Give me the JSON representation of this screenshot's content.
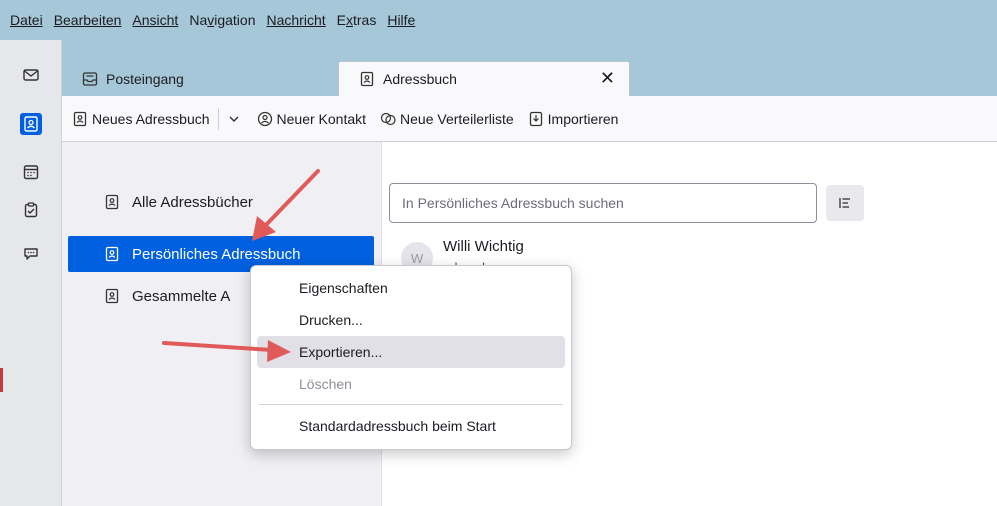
{
  "menubar": {
    "items": [
      {
        "label": "Datei",
        "accel_index": 0
      },
      {
        "label": "Bearbeiten",
        "accel_index": 0
      },
      {
        "label": "Ansicht",
        "accel_index": 0
      },
      {
        "label": "Navigation",
        "accel_index": 2
      },
      {
        "label": "Nachricht",
        "accel_index": 0
      },
      {
        "label": "Extras",
        "accel_index": 1
      },
      {
        "label": "Hilfe",
        "accel_index": 0
      }
    ]
  },
  "spaces": {
    "items": [
      "mail-icon",
      "address-book-icon",
      "calendar-icon",
      "tasks-icon",
      "chat-icon"
    ],
    "active": "address-book-icon",
    "accent_color": "#0060df"
  },
  "tabs": [
    {
      "label": "Posteingang",
      "icon": "inbox-icon"
    },
    {
      "label": "Adressbuch",
      "icon": "address-book-icon",
      "close_label": "✕"
    }
  ],
  "toolbar": {
    "new_book": "Neues Adressbuch",
    "new_contact": "Neuer Kontakt",
    "new_list": "Neue Verteilerliste",
    "import": "Importieren"
  },
  "sidebar": {
    "books": [
      {
        "label": "Alle Adressbücher"
      },
      {
        "label": "Persönliches Adressbuch"
      },
      {
        "label": "Gesammelte A"
      }
    ],
    "selected_index": 1
  },
  "search": {
    "placeholder": "In Persönliches Adressbuch suchen"
  },
  "contacts": [
    {
      "initial": "W",
      "name": "Willi Wichtig",
      "email_tail": "ndwo.de"
    }
  ],
  "context_menu": {
    "items": [
      {
        "label": "Eigenschaften",
        "disabled": false
      },
      {
        "label": "Drucken...",
        "disabled": false
      },
      {
        "label": "Exportieren...",
        "disabled": false,
        "highlighted": true
      },
      {
        "label": "Löschen",
        "disabled": true
      },
      {
        "label": "Standardadressbuch beim Start",
        "disabled": false
      }
    ]
  },
  "colors": {
    "menubar_bg": "#a6c7d7",
    "selection": "#0060df",
    "annotation_arrow": "#e05a5a"
  }
}
